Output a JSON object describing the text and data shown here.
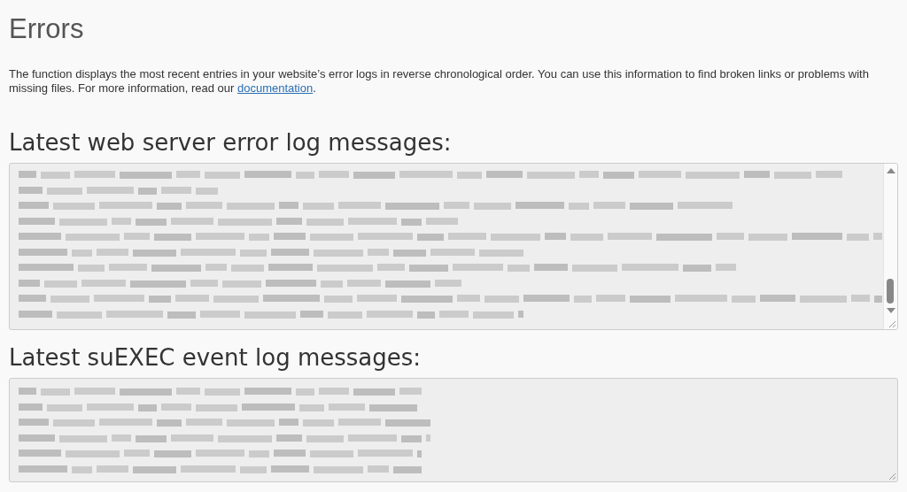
{
  "title": "Errors",
  "intro": {
    "text": "The function displays the most recent entries in your website’s error logs in reverse chronological order. You can use this information to find broken links or problems with missing files. For more information, read our ",
    "link": "documentation",
    "after": "."
  },
  "sections": [
    {
      "heading": "Latest web server error log messages:",
      "scrollable": true,
      "log_lines": [
        {
          "kind": "pixelated"
        },
        {
          "kind": "pixelated"
        },
        {
          "kind": "pixelated"
        },
        {
          "kind": "pixelated"
        },
        {
          "kind": "pixelated"
        },
        {
          "kind": "pixelated"
        },
        {
          "kind": "pixelated"
        },
        {
          "kind": "pixelated"
        },
        {
          "kind": "pixelated"
        },
        {
          "kind": "pixelated"
        }
      ]
    },
    {
      "heading": "Latest suEXEC event log messages:",
      "scrollable": false,
      "log_lines": [
        {
          "kind": "pixelated"
        },
        {
          "kind": "pixelated"
        },
        {
          "kind": "pixelated"
        },
        {
          "kind": "pixelated"
        },
        {
          "kind": "pixelated"
        },
        {
          "kind": "pixelated"
        }
      ]
    }
  ]
}
